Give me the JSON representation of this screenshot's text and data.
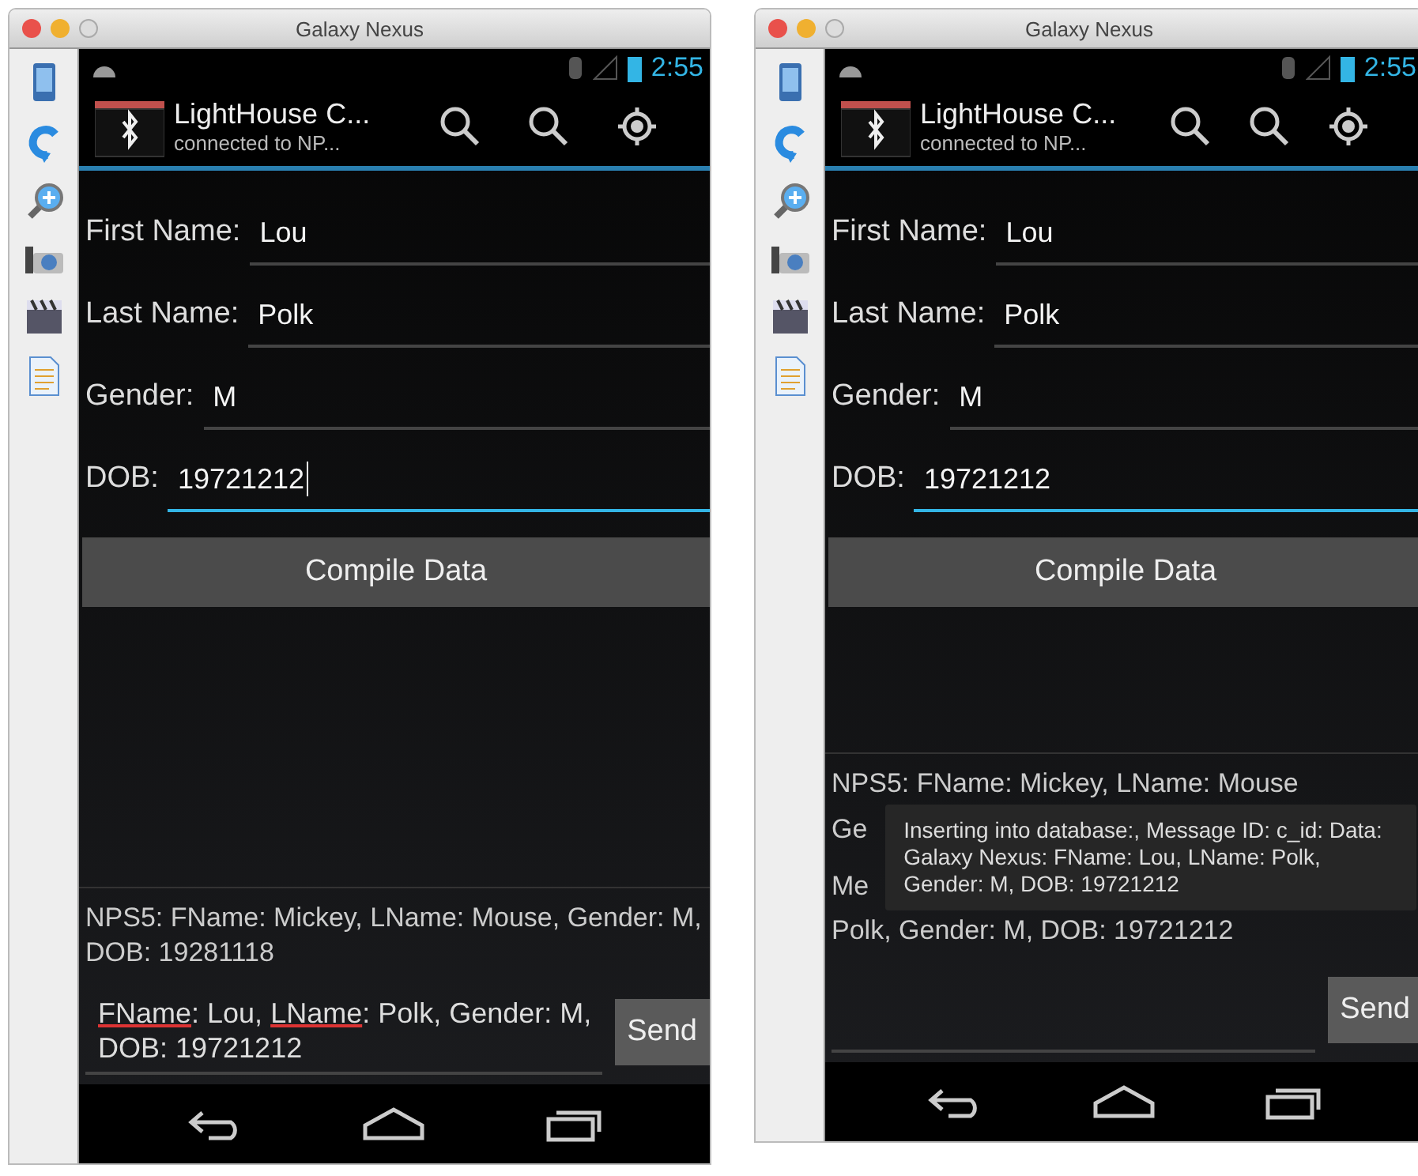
{
  "windows": [
    {
      "title": "Galaxy Nexus",
      "status_time": "2:55",
      "app_title": "LightHouse C...",
      "app_subtitle": "connected to NP...",
      "form": [
        {
          "label": "First Name:",
          "value": "Lou",
          "focused": false,
          "cursor": false
        },
        {
          "label": "Last Name:",
          "value": "Polk",
          "focused": false,
          "cursor": false
        },
        {
          "label": "Gender:",
          "value": "M",
          "focused": false,
          "cursor": false
        },
        {
          "label": "DOB:",
          "value": "19721212",
          "focused": true,
          "cursor": true
        }
      ],
      "compile_button": "Compile Data",
      "messages": [
        {
          "kind": "line",
          "text": "NPS5:  FName: Mickey, LName: Mouse, Gender: M, DOB: 19281118"
        }
      ],
      "input": [
        {
          "text": "FName",
          "misspelled": true
        },
        {
          "text": ": Lou, ",
          "misspelled": false
        },
        {
          "text": "LName",
          "misspelled": true
        },
        {
          "text": ": Polk, Gender: M, DOB: 19721212",
          "misspelled": false
        }
      ],
      "send_button": "Send"
    },
    {
      "title": "Galaxy Nexus",
      "status_time": "2:55",
      "app_title": "LightHouse C...",
      "app_subtitle": "connected to NP...",
      "form": [
        {
          "label": "First Name:",
          "value": "Lou",
          "focused": false,
          "cursor": false
        },
        {
          "label": "Last Name:",
          "value": "Polk",
          "focused": false,
          "cursor": false
        },
        {
          "label": "Gender:",
          "value": "M",
          "focused": false,
          "cursor": false
        },
        {
          "label": "DOB:",
          "value": "19721212",
          "focused": true,
          "cursor": false
        }
      ],
      "compile_button": "Compile Data",
      "messages": [
        {
          "kind": "line",
          "text": "NPS5:  FName: Mickey, LName: Mouse"
        },
        {
          "kind": "toast_row",
          "fragments": [
            "Ge",
            "Me"
          ],
          "toast": "Inserting into database:, Message ID: c_id: Data: Galaxy Nexus: FName: Lou, LName: Polk, Gender: M, DOB: 19721212"
        },
        {
          "kind": "line",
          "text": "Polk, Gender: M, DOB: 19721212"
        }
      ],
      "send_button": "Send"
    }
  ]
}
